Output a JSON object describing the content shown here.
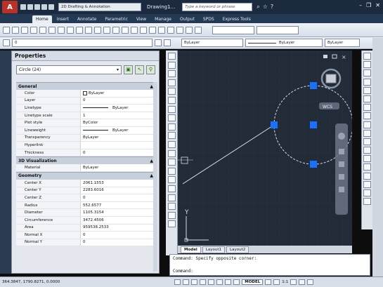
{
  "titlebar": {
    "app_button": "A",
    "workspace": "2D Drafting & Annotation",
    "document_title": "Drawing1...",
    "search_placeholder": "Type a keyword or phrase"
  },
  "ribbon_tabs": [
    "Home",
    "Insert",
    "Annotate",
    "Parametric",
    "View",
    "Manage",
    "Output",
    "SPDS",
    "Express Tools"
  ],
  "toolbar": {
    "layer_value": "0",
    "color_value": "ByLayer",
    "linetype_value": "ByLayer",
    "lineweight_value": "ByLayer"
  },
  "properties": {
    "title": "Properties",
    "selection": "Circle (24)",
    "sections": [
      {
        "name": "General",
        "rows": [
          {
            "name": "Color",
            "value": "ByLayer",
            "swatch": true
          },
          {
            "name": "Layer",
            "value": "0"
          },
          {
            "name": "Linetype",
            "value": "ByLayer",
            "line": true
          },
          {
            "name": "Linetype scale",
            "value": "1"
          },
          {
            "name": "Plot style",
            "value": "ByColor"
          },
          {
            "name": "Lineweight",
            "value": "ByLayer",
            "line": true
          },
          {
            "name": "Transparency",
            "value": "ByLayer"
          },
          {
            "name": "Hyperlink",
            "value": ""
          },
          {
            "name": "Thickness",
            "value": "0"
          }
        ]
      },
      {
        "name": "3D Visualization",
        "rows": [
          {
            "name": "Material",
            "value": "ByLayer"
          }
        ]
      },
      {
        "name": "Geometry",
        "rows": [
          {
            "name": "Center X",
            "value": "2061.1553"
          },
          {
            "name": "Center Y",
            "value": "2283.6016"
          },
          {
            "name": "Center Z",
            "value": "0"
          },
          {
            "name": "Radius",
            "value": "552.6577"
          },
          {
            "name": "Diameter",
            "value": "1105.3154"
          },
          {
            "name": "Circumference",
            "value": "3472.4506"
          },
          {
            "name": "Area",
            "value": "959538.2533"
          },
          {
            "name": "Normal X",
            "value": "0"
          },
          {
            "name": "Normal Y",
            "value": "0"
          }
        ]
      }
    ]
  },
  "viewport": {
    "viewcube_label": "WCS",
    "axis_y": "Y",
    "accent": "#1b6fff",
    "background": "#222b38"
  },
  "layout_tabs": [
    "Model",
    "Layout1",
    "Layout2"
  ],
  "command_line": {
    "history": "Command: Specify opposite corner:",
    "prompt": "Command:"
  },
  "status": {
    "coordinates": "364.3847, 1790.8271, 0.0000",
    "model_label": "MODEL",
    "scale": "1:1"
  }
}
